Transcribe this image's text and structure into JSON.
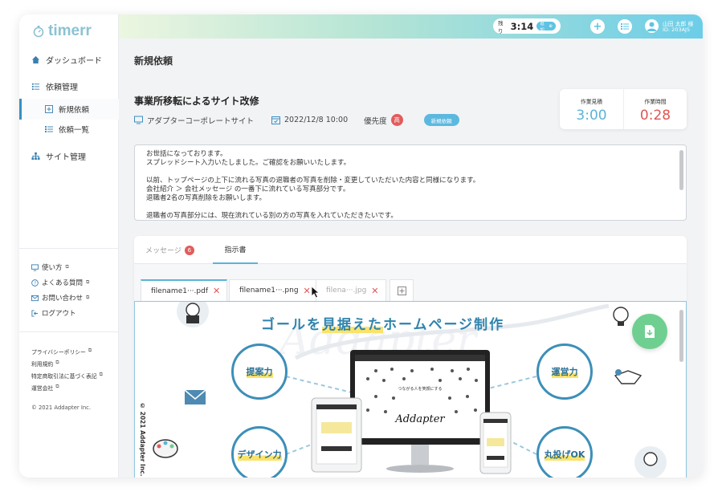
{
  "app": {
    "logo_text": "timerr",
    "copyright": "© 2021 Addapter Inc."
  },
  "header": {
    "remain_label": "残り",
    "remain_time": "3:14",
    "extend_label": "追加",
    "user_name": "山田 太郎 様",
    "user_id": "ID: 203AJ5"
  },
  "sidebar": {
    "dashboard": "ダッシュボード",
    "requests": "依頼管理",
    "new_request": "新規依頼",
    "request_list": "依頼一覧",
    "site_management": "サイト管理",
    "help": "使い方",
    "faq": "よくある質問",
    "contact": "お問い合わせ",
    "logout": "ログアウト",
    "privacy": "プライバシーポリシー",
    "terms": "利用規約",
    "commerce": "特定商取引法に基づく表記",
    "company": "運営会社"
  },
  "main": {
    "page_title": "新規依頼",
    "job_title": "事業所移転によるサイト改修",
    "site_name": "アダプターコーポレートサイト",
    "date": "2022/12/8 10:00",
    "priority_label": "優先度",
    "priority_value": "高",
    "status": "新規依頼",
    "estimate_label": "作業見積",
    "estimate_value": "3:00",
    "actual_label": "作業時間",
    "actual_value": "0:28",
    "message_lines": [
      "お世話になっております。",
      "スプレッドシート入力いたしました。ご確認をお願いいたします。",
      "",
      "以前、トップページの上下に流れる写真の退職者の写真を削除・変更していただいた内容と同様になります。",
      "会社紹介 ＞ 会社メッセージ の一番下に流れている写真部分です。",
      "退職者2名の写真削除をお願いします。",
      "",
      "退職者の写真部分には、現在流れている別の方の写真を入れていただきたいです。"
    ]
  },
  "tabs": {
    "message": "メッセージ",
    "message_count": "6",
    "spec": "指示書"
  },
  "files": [
    {
      "name": "filename1···.pdf"
    },
    {
      "name": "filename1···.png"
    },
    {
      "name": "filena···.jpg"
    }
  ],
  "preview": {
    "title_pre": "ゴールを",
    "title_hl": "見据えた",
    "title_post": "ホームページ制作",
    "watermark": "Addapter",
    "skill_1": "提案力",
    "skill_2": "運営力",
    "skill_3": "デザイン力",
    "skill_4": "丸投げOK",
    "screen_tagline": "つながる人を笑顔にする",
    "screen_brand": "Addapter",
    "credit": "© 2021 Addapter Inc."
  },
  "colors": {
    "accent": "#5ab4d8",
    "danger": "#e05555",
    "success": "#6fcf90",
    "highlight": "#fbe36b"
  }
}
